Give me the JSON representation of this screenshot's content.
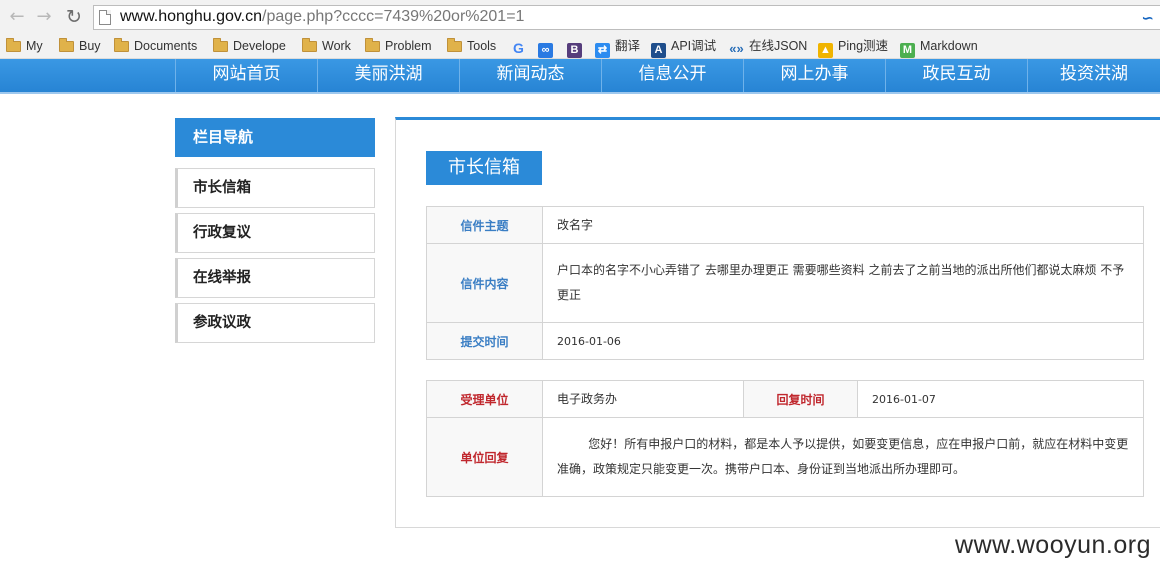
{
  "browser": {
    "url_host": "www.honghu.gov.cn",
    "url_path": "/page.php?cccc=7439%20or%201=1",
    "icons": {
      "back": "back-arrow-icon",
      "forward": "forward-arrow-icon",
      "reload": "reload-icon",
      "page": "page-icon",
      "extension": "extension-icon"
    },
    "bookmarks": [
      {
        "label": "My",
        "icon": "folder-icon"
      },
      {
        "label": "Buy",
        "icon": "folder-icon"
      },
      {
        "label": "Documents",
        "icon": "folder-icon"
      },
      {
        "label": "Develope",
        "icon": "folder-icon"
      },
      {
        "label": "Work",
        "icon": "folder-icon"
      },
      {
        "label": "Problem",
        "icon": "folder-icon"
      },
      {
        "label": "Tools",
        "icon": "folder-icon"
      },
      {
        "label": "",
        "icon": "google-icon"
      },
      {
        "label": "",
        "icon": "baidu-icon"
      },
      {
        "label": "",
        "icon": "bootstrap-icon"
      },
      {
        "label": "翻译",
        "icon": "translate-icon"
      },
      {
        "label": "API调试",
        "icon": "api-icon"
      },
      {
        "label": "在线JSON",
        "icon": "json-icon"
      },
      {
        "label": "Ping测速",
        "icon": "ping-icon"
      },
      {
        "label": "Markdown",
        "icon": "markdown-icon"
      }
    ]
  },
  "site_nav": [
    "网站首页",
    "美丽洪湖",
    "新闻动态",
    "信息公开",
    "网上办事",
    "政民互动",
    "投资洪湖"
  ],
  "sidebar": {
    "title": "栏目导航",
    "items": [
      "市长信箱",
      "行政复议",
      "在线举报",
      "参政议政"
    ]
  },
  "main": {
    "title": "市长信箱",
    "letter": {
      "subject_label": "信件主题",
      "subject": "改名字",
      "content_label": "信件内容",
      "content": "户口本的名字不小心弄错了 去哪里办理更正 需要哪些资料 之前去了之前当地的派出所他们都说太麻烦 不予更正",
      "submit_time_label": "提交时间",
      "submit_time": "2016-01-06"
    },
    "reply": {
      "dept_label": "受理单位",
      "dept": "电子政务办",
      "reply_time_label": "回复时间",
      "reply_time": "2016-01-07",
      "reply_label": "单位回复",
      "reply_text": "您好！所有申报户口的材料，都是本人予以提供，如要变更信息，应在申报户口前，就应在材料中变更准确，政策规定只能变更一次。携带户口本、身份证到当地派出所办理即可。"
    }
  },
  "watermark": "www.wooyun.org",
  "colors": {
    "nav_blue": "#2b8ad8",
    "label_blue": "#3a7ec4",
    "label_red": "#c0272d"
  }
}
